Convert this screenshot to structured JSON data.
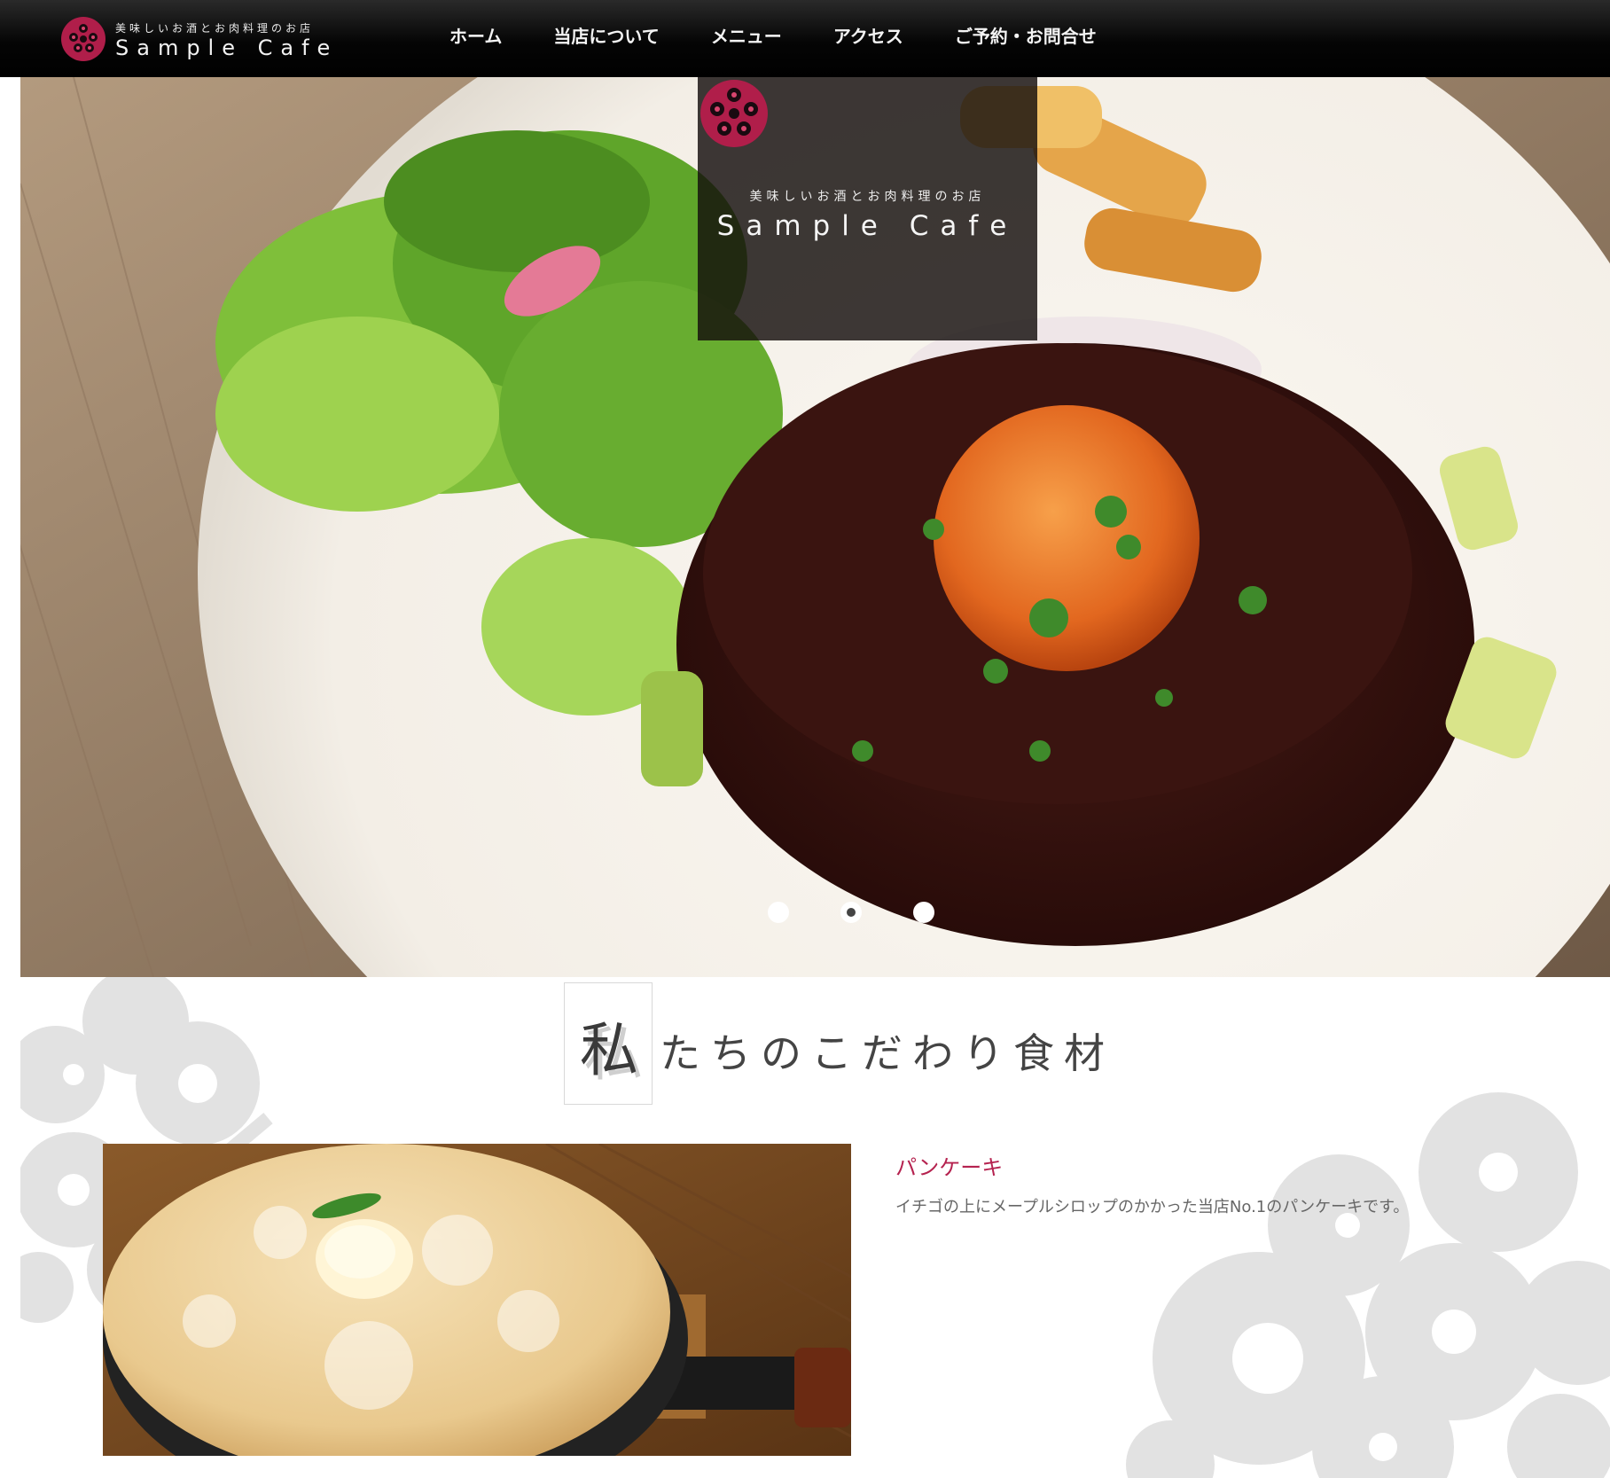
{
  "header": {
    "logo": {
      "tagline": "美味しいお酒とお肉料理のお店",
      "name": "Sample Cafe"
    },
    "nav": [
      {
        "label": "ホーム"
      },
      {
        "label": "当店について"
      },
      {
        "label": "メニュー"
      },
      {
        "label": "アクセス"
      },
      {
        "label": "ご予約・お問合せ"
      }
    ]
  },
  "hero": {
    "logo": {
      "tagline": "美味しいお酒とお肉料理のお店",
      "name": "Sample Cafe"
    },
    "slides": {
      "count": 3,
      "active_index": 2
    }
  },
  "section": {
    "heading_first_char": "私",
    "heading_rest": "たちのこだわり食材",
    "item": {
      "title": "パンケーキ",
      "description": "イチゴの上にメープルシロップのかかった当店No.1のパンケーキです。"
    }
  },
  "colors": {
    "accent": "#b5224f",
    "header_bg": "#000000",
    "deco_gray": "#e2e2e2"
  }
}
